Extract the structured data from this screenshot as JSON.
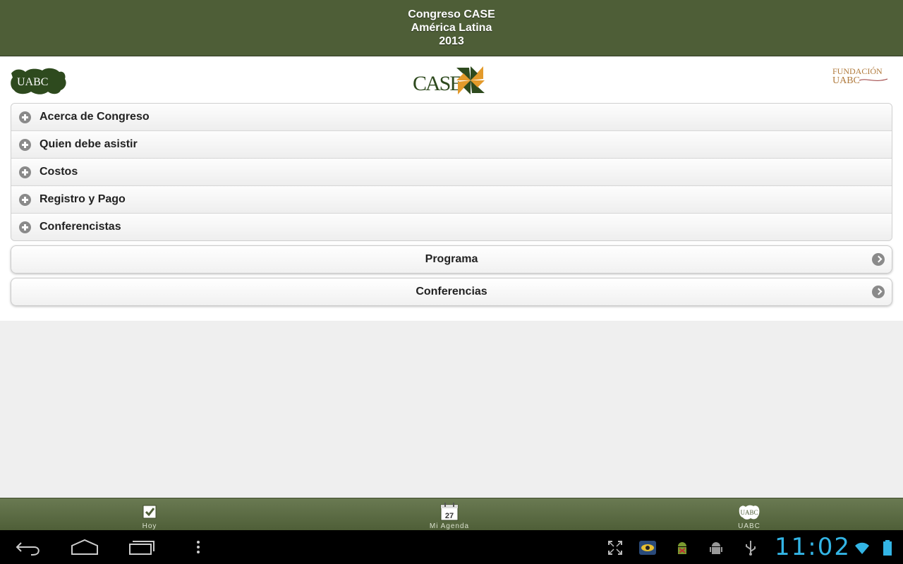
{
  "header": {
    "title_line1": "Congreso CASE",
    "title_line2": "América Latina",
    "title_line3": "2013"
  },
  "logos": {
    "left": "UABC",
    "center": "CASE",
    "right_line1": "FUNDACIÓN",
    "right_line2": "UABC"
  },
  "collapsibles": [
    {
      "label": "Acerca de Congreso",
      "icon": "plus-icon"
    },
    {
      "label": "Quien debe asistir",
      "icon": "plus-icon"
    },
    {
      "label": "Costos",
      "icon": "plus-icon"
    },
    {
      "label": "Registro y Pago",
      "icon": "plus-icon"
    },
    {
      "label": "Conferencistas",
      "icon": "plus-icon"
    }
  ],
  "nav_buttons": [
    {
      "label": "Programa",
      "icon": "arrow-right-icon"
    },
    {
      "label": "Conferencias",
      "icon": "arrow-right-icon"
    }
  ],
  "tabbar": {
    "hoy": {
      "label": "Hoy",
      "icon": "checkbox-icon"
    },
    "agenda": {
      "label": "Mi Agenda",
      "icon": "calendar-icon",
      "day": "27"
    },
    "uabc": {
      "label": "UABC",
      "icon": "uabc-logo-icon"
    }
  },
  "system_bar": {
    "time": "11:02",
    "icons": [
      "back-icon",
      "home-icon",
      "recent-apps-icon",
      "menu-icon",
      "fullscreen-icon",
      "eye-app-icon",
      "android-debug-icon",
      "android-icon",
      "usb-icon",
      "wifi-icon",
      "battery-icon"
    ]
  },
  "colors": {
    "header_bg": "#4e5e37",
    "tabbar_bg": "#5c6c44",
    "clock": "#33b5e5",
    "logo_green": "#2e4a1e",
    "case_orange": "#e39a2b"
  }
}
